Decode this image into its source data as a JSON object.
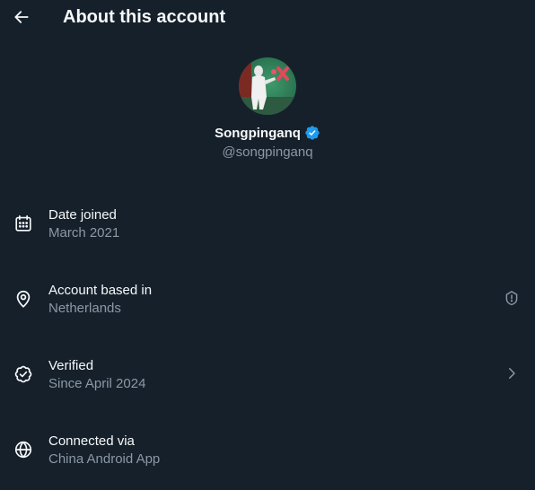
{
  "header": {
    "title": "About this account"
  },
  "profile": {
    "display_name": "Songpinganq",
    "handle": "@songpinganq",
    "verified": true
  },
  "details": [
    {
      "label": "Date joined",
      "value": "March 2021",
      "icon": "calendar-icon"
    },
    {
      "label": "Account based in",
      "value": "Netherlands",
      "icon": "location-pin-icon",
      "trailing_icon": "shield-alert-icon"
    },
    {
      "label": "Verified",
      "value": "Since April 2024",
      "icon": "verified-check-icon",
      "trailing_icon": "chevron-right-icon"
    },
    {
      "label": "Connected via",
      "value": "China Android App",
      "icon": "globe-icon"
    }
  ],
  "colors": {
    "background": "#15202b",
    "text_primary": "#f7f9f9",
    "text_secondary": "#8b98a5",
    "verified_blue": "#1d9bf0"
  }
}
